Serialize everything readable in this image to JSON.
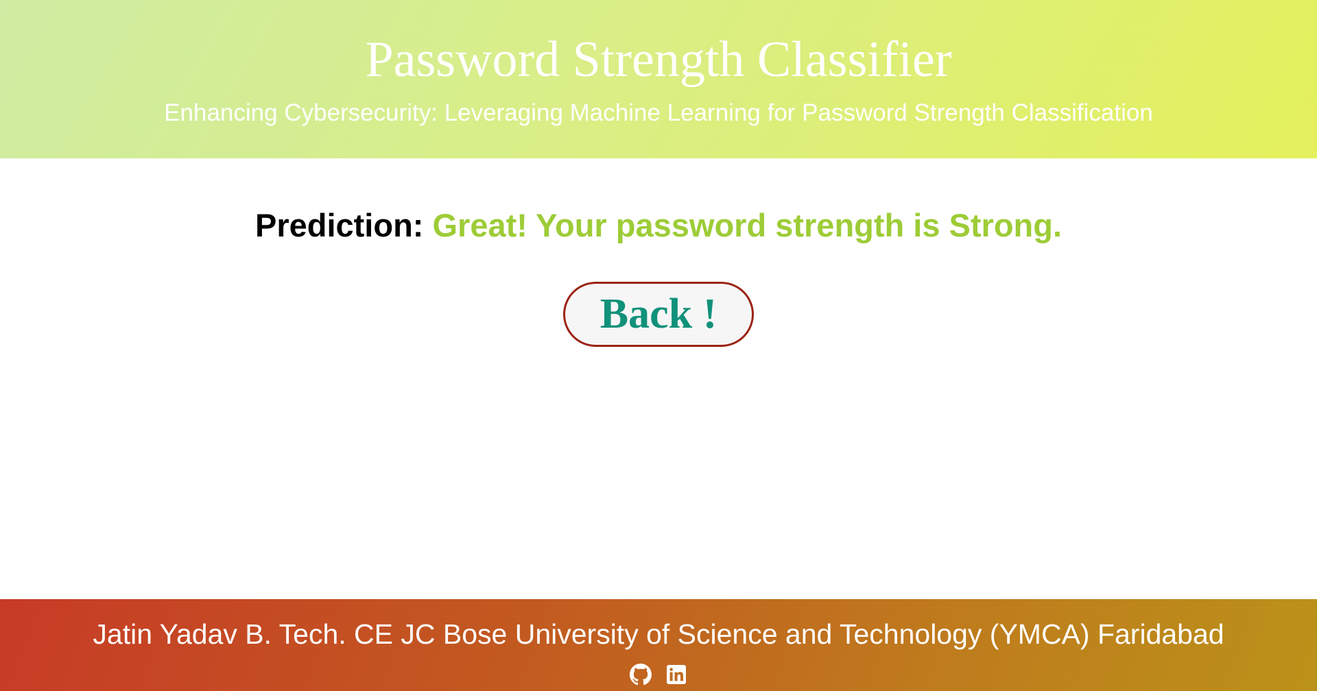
{
  "header": {
    "title": "Password Strength Classifier",
    "subtitle": "Enhancing Cybersecurity: Leveraging Machine Learning for Password Strength Classification"
  },
  "result": {
    "label": "Prediction:",
    "message": "Great! Your password strength is Strong."
  },
  "back_button": {
    "label": "Back !"
  },
  "footer": {
    "credit": "Jatin Yadav B. Tech. CE JC Bose University of Science and Technology (YMCA) Faridabad",
    "social": [
      {
        "icon": "github-icon"
      },
      {
        "icon": "linkedin-icon"
      }
    ]
  },
  "colors": {
    "header_gradient_start": "#cfeca2",
    "header_gradient_end": "#e4f05c",
    "result_text": "#9dcc37",
    "button_border": "#9b2315",
    "button_text": "#11917a",
    "footer_gradient_start": "#c73b26",
    "footer_gradient_end": "#bb9219"
  }
}
